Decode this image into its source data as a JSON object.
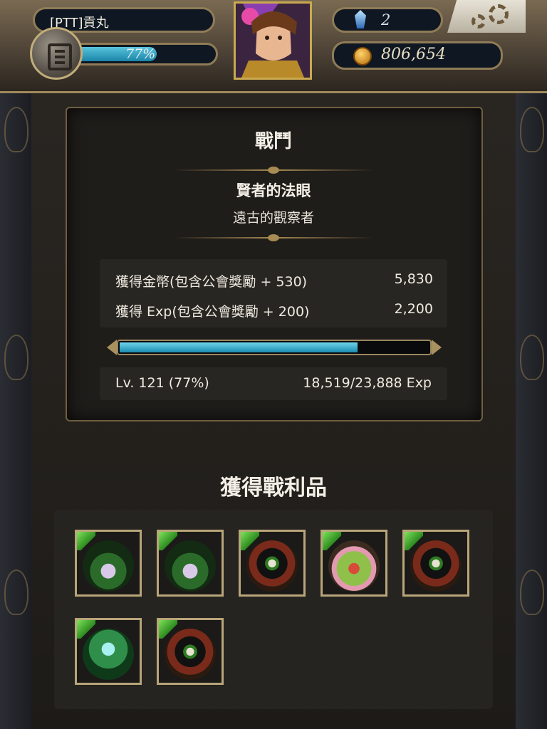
{
  "header": {
    "player_name": "[PTT]貢丸",
    "exp_percent": 77,
    "exp_percent_label": "77%",
    "gems": "2",
    "coins": "806,654"
  },
  "battle": {
    "title": "戰鬥",
    "stage_name": "賢者的法眼",
    "stage_subtitle": "遠古的觀察者",
    "rewards": [
      {
        "label": "獲得金幣(包含公會獎勵 + 530)",
        "value": "5,830"
      },
      {
        "label": "獲得 Exp(包含公會獎勵 + 200)",
        "value": "2,200"
      }
    ],
    "level_progress": 0.77,
    "level_label": "Lv. 121 (77%)",
    "exp_label": "18,519/23,888 Exp"
  },
  "loot": {
    "title": "獲得戰利品",
    "items": [
      {
        "name": "vine-card",
        "art": "vine"
      },
      {
        "name": "vine-card",
        "art": "vine"
      },
      {
        "name": "hat-eye-card",
        "art": "hatman"
      },
      {
        "name": "toad-card",
        "art": "toad"
      },
      {
        "name": "hat-eye-card",
        "art": "hatman"
      },
      {
        "name": "ghost-card",
        "art": "ghost"
      },
      {
        "name": "hat-eye-card",
        "art": "hatman"
      }
    ]
  },
  "colors": {
    "exp_fill": "#1a84a8",
    "frame_gold": "#a08a5c",
    "element_wood": "#2c8a1f"
  }
}
